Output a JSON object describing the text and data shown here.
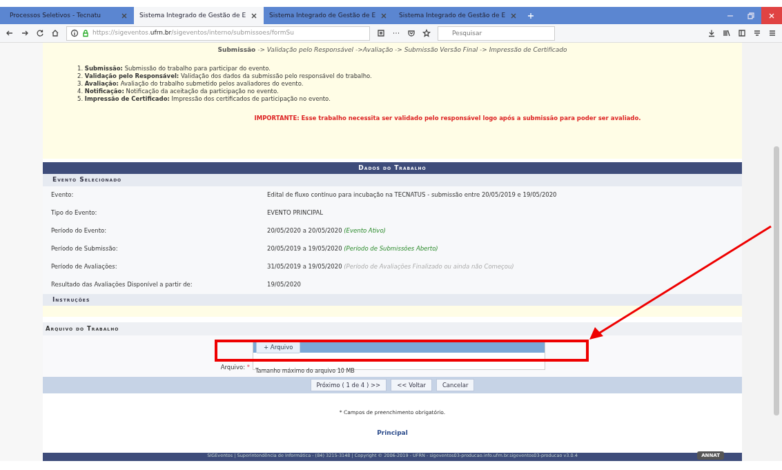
{
  "browser": {
    "tabs": [
      {
        "title": "Processos Seletivos - Tecnatu",
        "selected": false
      },
      {
        "title": "Sistema Integrado de Gestão de E",
        "selected": true
      },
      {
        "title": "Sistema Integrado de Gestão de E",
        "selected": false
      },
      {
        "title": "Sistema Integrado de Gestão de E",
        "selected": false
      }
    ],
    "url_prefix": "https://sigeventos.",
    "url_domain": "ufrn.br",
    "url_rest": "/sigeventos/interno/submissoes/formSu",
    "search": {
      "placeholder": "Pesquisar"
    }
  },
  "steps": "**Submissão** *-> Validação pelo Responsável ->Avaliação -> Submissão Versão Final -> Impressão de Certificado*",
  "instructions": [
    "1. **Submissão:** Submissão do trabalho para participar do evento.",
    "2. **Validação pelo Responsável:** Validação dos dados da submissão pelo responsável do trabalho.",
    "3. **Avaliação:** Avaliação do trabalho submetido pelos avaliadores do evento.",
    "4. **Notificação:** Notificação da aceitação da participação no evento.",
    "5. **Impressão de Certificado:** Impressão dos certificados de participação no evento."
  ],
  "important": "IMPORTANTE: Esse trabalho necessita ser validado pelo responsável logo após a submissão para poder ser avaliado.",
  "panel": {
    "title": "Dados do Trabalho",
    "subtitle": "Evento Selecionado",
    "rows": [
      {
        "label": "Evento:",
        "value": "Edital de fluxo contínuo para incubação na TECNATUS - submissão entre 20/05/2019 e 19/05/2020"
      },
      {
        "label": "Tipo do Evento:",
        "value": "EVENTO PRINCIPAL"
      },
      {
        "label": "Período do Evento:",
        "value": "20/05/2020 a 20/05/2020",
        "note": "(Evento Ativo)",
        "kind": "open"
      },
      {
        "label": "Período de Submissão:",
        "value": "20/05/2019 a 19/05/2020",
        "note": "(Período de Submissões Aberto)",
        "kind": "open"
      },
      {
        "label": "Período de Avaliações:",
        "value": "31/05/2019 a 19/05/2020",
        "note": "(Período de Avaliações Finalizado ou ainda não Começou)",
        "kind": "closed"
      },
      {
        "label": "Resultado das Avaliações Disponível a partir de:",
        "value": "19/05/2020"
      }
    ],
    "instructions_title": "Instruções"
  },
  "file_section": {
    "title": "Arquivo do Trabalho",
    "field_label": "Arquivo:",
    "required_mark": "*",
    "upload_button": "+ Arquivo",
    "hint": "Tamanho máximo do arquivo 10 MB"
  },
  "buttons": [
    "Próximo ( 1 de 4 ) >>",
    "<< Voltar",
    "Cancelar"
  ],
  "required_note": "Campos de preenchimento obrigatório.",
  "required_star": "*",
  "main_link": "Principal",
  "footer": "SIGEventos | Superintendência de Informática - (84) 3215-3148 | Copyright © 2006-2019 - UFRN - sigeventos03-producao.info.ufrn.br.sigeventos03-producao v3.0.4",
  "badge": "ANNAT"
}
